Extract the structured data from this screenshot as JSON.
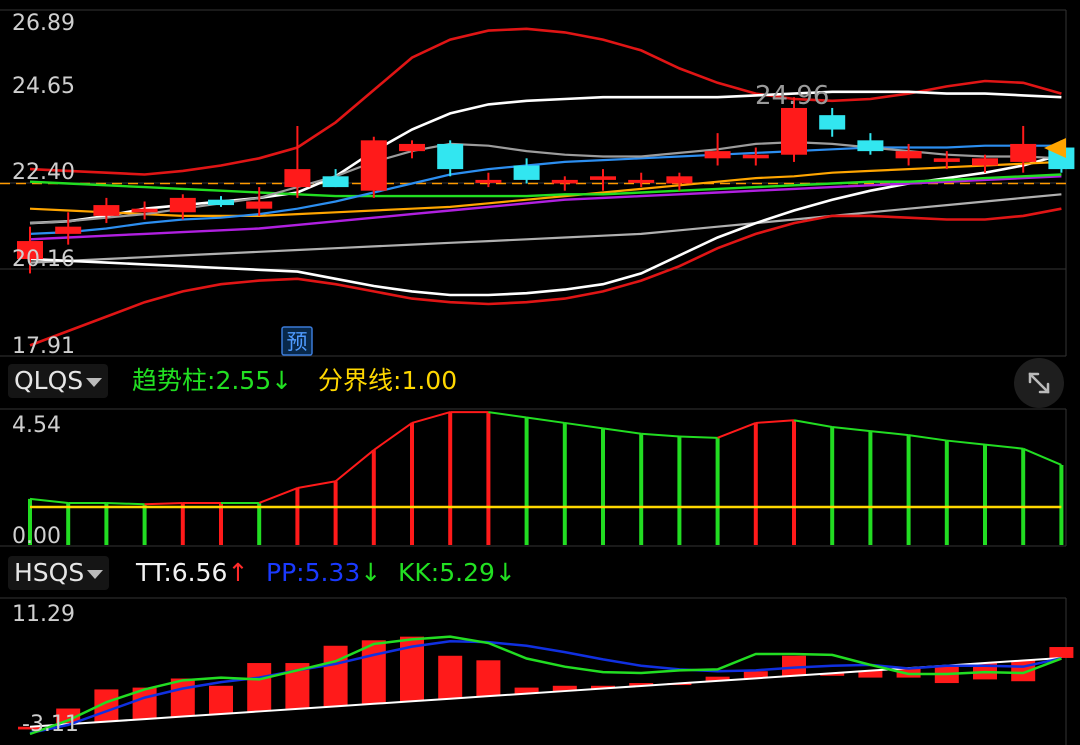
{
  "top_panel": {
    "y_labels": [
      "26.89",
      "24.65",
      "22.40",
      "20.16",
      "17.91"
    ],
    "price_tag": "24.96",
    "pre_badge": "预"
  },
  "mid_panel": {
    "indicator": "QLQS",
    "line1_label": "趋势柱:",
    "line1_value": "2.55",
    "line1_arrow": "↓",
    "line2_label": "分界线:",
    "line2_value": "1.00",
    "y_labels": [
      "4.54",
      "0.00"
    ]
  },
  "bot_panel": {
    "indicator": "HSQS",
    "tt_label": "TT:",
    "tt_value": "6.56",
    "tt_arrow": "↑",
    "pp_label": "PP:",
    "pp_value": "5.33",
    "pp_arrow": "↓",
    "kk_label": "KK:",
    "kk_value": "5.29",
    "kk_arrow": "↓",
    "y_labels": [
      "11.29",
      "-3.11"
    ]
  },
  "colors": {
    "up": "#ff1a1a",
    "down": "#32e6f0",
    "green": "#22dd22",
    "yellow": "#ffd700",
    "blue": "#1030e0",
    "white": "#ffffff"
  },
  "chart_data": [
    {
      "type": "candlestick",
      "ylim": [
        17.91,
        26.89
      ],
      "y_ticks": [
        26.89,
        24.65,
        22.4,
        20.16,
        17.91
      ],
      "reference_line": 22.4,
      "candles": [
        {
          "o": 20.3,
          "h": 21.2,
          "l": 19.9,
          "c": 20.8,
          "dir": "up"
        },
        {
          "o": 21.0,
          "h": 21.6,
          "l": 20.7,
          "c": 21.2,
          "dir": "up"
        },
        {
          "o": 21.5,
          "h": 22.0,
          "l": 21.3,
          "c": 21.8,
          "dir": "up"
        },
        {
          "o": 21.6,
          "h": 21.9,
          "l": 21.4,
          "c": 21.7,
          "dir": "up"
        },
        {
          "o": 21.6,
          "h": 22.1,
          "l": 21.4,
          "c": 22.0,
          "dir": "up"
        },
        {
          "o": 21.95,
          "h": 22.05,
          "l": 21.75,
          "c": 21.8,
          "dir": "down"
        },
        {
          "o": 21.7,
          "h": 22.3,
          "l": 21.5,
          "c": 21.9,
          "dir": "up"
        },
        {
          "o": 22.3,
          "h": 24.0,
          "l": 22.0,
          "c": 22.8,
          "dir": "up"
        },
        {
          "o": 22.6,
          "h": 22.8,
          "l": 22.3,
          "c": 22.3,
          "dir": "down"
        },
        {
          "o": 22.2,
          "h": 23.7,
          "l": 22.0,
          "c": 23.6,
          "dir": "up"
        },
        {
          "o": 23.3,
          "h": 23.6,
          "l": 23.1,
          "c": 23.5,
          "dir": "up"
        },
        {
          "o": 23.5,
          "h": 23.6,
          "l": 22.6,
          "c": 22.8,
          "dir": "down"
        },
        {
          "o": 22.5,
          "h": 22.7,
          "l": 22.3,
          "c": 22.5,
          "dir": "up"
        },
        {
          "o": 22.9,
          "h": 23.1,
          "l": 22.4,
          "c": 22.5,
          "dir": "down"
        },
        {
          "o": 22.4,
          "h": 22.6,
          "l": 22.2,
          "c": 22.5,
          "dir": "up"
        },
        {
          "o": 22.5,
          "h": 22.8,
          "l": 22.2,
          "c": 22.6,
          "dir": "up"
        },
        {
          "o": 22.5,
          "h": 22.7,
          "l": 22.3,
          "c": 22.5,
          "dir": "up"
        },
        {
          "o": 22.4,
          "h": 22.7,
          "l": 22.2,
          "c": 22.6,
          "dir": "up"
        },
        {
          "o": 23.1,
          "h": 23.8,
          "l": 22.9,
          "c": 23.3,
          "dir": "up"
        },
        {
          "o": 23.1,
          "h": 23.4,
          "l": 22.9,
          "c": 23.2,
          "dir": "up"
        },
        {
          "o": 23.2,
          "h": 24.8,
          "l": 23.0,
          "c": 24.5,
          "dir": "up"
        },
        {
          "o": 24.3,
          "h": 24.5,
          "l": 23.7,
          "c": 23.9,
          "dir": "down"
        },
        {
          "o": 23.6,
          "h": 23.8,
          "l": 23.2,
          "c": 23.3,
          "dir": "down"
        },
        {
          "o": 23.1,
          "h": 23.5,
          "l": 22.9,
          "c": 23.3,
          "dir": "up"
        },
        {
          "o": 23.0,
          "h": 23.3,
          "l": 22.8,
          "c": 23.1,
          "dir": "up"
        },
        {
          "o": 22.9,
          "h": 23.2,
          "l": 22.7,
          "c": 23.1,
          "dir": "up"
        },
        {
          "o": 23.0,
          "h": 24.0,
          "l": 22.7,
          "c": 23.5,
          "dir": "up"
        },
        {
          "o": 23.4,
          "h": 23.6,
          "l": 22.7,
          "c": 22.8,
          "dir": "down"
        }
      ],
      "lines": {
        "red_upper": [
          22.8,
          22.75,
          22.7,
          22.65,
          22.75,
          22.9,
          23.1,
          23.4,
          24.1,
          25.0,
          25.9,
          26.4,
          26.65,
          26.7,
          26.6,
          26.4,
          26.1,
          25.6,
          25.2,
          24.9,
          24.75,
          24.7,
          24.75,
          24.9,
          25.1,
          25.25,
          25.2,
          24.9
        ],
        "red_lower": [
          17.9,
          18.3,
          18.7,
          19.1,
          19.4,
          19.6,
          19.7,
          19.75,
          19.6,
          19.4,
          19.2,
          19.1,
          19.05,
          19.1,
          19.2,
          19.4,
          19.7,
          20.1,
          20.6,
          21.0,
          21.3,
          21.5,
          21.5,
          21.45,
          21.4,
          21.4,
          21.5,
          21.7
        ],
        "white_upper": [
          21.3,
          21.35,
          21.5,
          21.7,
          21.8,
          21.9,
          22.0,
          22.15,
          22.6,
          23.3,
          23.9,
          24.35,
          24.6,
          24.7,
          24.75,
          24.8,
          24.8,
          24.8,
          24.8,
          24.85,
          24.9,
          24.95,
          24.95,
          24.95,
          24.9,
          24.9,
          24.85,
          24.8
        ],
        "white_lower": [
          20.3,
          20.25,
          20.2,
          20.15,
          20.1,
          20.05,
          20.0,
          19.95,
          19.75,
          19.55,
          19.4,
          19.3,
          19.3,
          19.35,
          19.45,
          19.6,
          19.9,
          20.4,
          20.9,
          21.3,
          21.65,
          21.95,
          22.2,
          22.4,
          22.55,
          22.7,
          22.9,
          23.2
        ],
        "blue": [
          21.0,
          21.05,
          21.15,
          21.3,
          21.4,
          21.45,
          21.55,
          21.7,
          21.9,
          22.15,
          22.4,
          22.65,
          22.8,
          22.9,
          23.0,
          23.05,
          23.1,
          23.15,
          23.2,
          23.25,
          23.3,
          23.35,
          23.4,
          23.4,
          23.4,
          23.45,
          23.45,
          23.45
        ],
        "gray_short": [
          21.3,
          21.35,
          21.45,
          21.55,
          21.7,
          21.85,
          22.0,
          22.3,
          22.6,
          23.0,
          23.3,
          23.5,
          23.45,
          23.3,
          23.2,
          23.15,
          23.15,
          23.25,
          23.35,
          23.5,
          23.55,
          23.5,
          23.4,
          23.3,
          23.2,
          23.15,
          23.15,
          23.1
        ],
        "purple": [
          20.85,
          20.9,
          20.95,
          21.0,
          21.05,
          21.1,
          21.15,
          21.25,
          21.35,
          21.45,
          21.55,
          21.65,
          21.75,
          21.85,
          21.95,
          22.0,
          22.05,
          22.1,
          22.15,
          22.2,
          22.25,
          22.3,
          22.35,
          22.4,
          22.45,
          22.5,
          22.55,
          22.6
        ],
        "orange": [
          21.7,
          21.65,
          21.6,
          21.55,
          21.5,
          21.5,
          21.5,
          21.55,
          21.6,
          21.65,
          21.7,
          21.75,
          21.85,
          21.95,
          22.05,
          22.15,
          22.25,
          22.35,
          22.45,
          22.55,
          22.6,
          22.7,
          22.75,
          22.8,
          22.85,
          22.9,
          22.95,
          23.0
        ],
        "green": [
          22.45,
          22.4,
          22.35,
          22.3,
          22.25,
          22.2,
          22.15,
          22.1,
          22.05,
          22.05,
          22.05,
          22.05,
          22.05,
          22.05,
          22.1,
          22.1,
          22.15,
          22.2,
          22.25,
          22.3,
          22.35,
          22.4,
          22.45,
          22.45,
          22.5,
          22.55,
          22.6,
          22.65
        ],
        "gray_long": [
          20.2,
          20.25,
          20.3,
          20.35,
          20.4,
          20.45,
          20.5,
          20.55,
          20.6,
          20.65,
          20.7,
          20.75,
          20.8,
          20.85,
          20.9,
          20.95,
          21.0,
          21.1,
          21.2,
          21.3,
          21.4,
          21.5,
          21.6,
          21.7,
          21.8,
          21.9,
          22.0,
          22.1
        ]
      }
    },
    {
      "type": "bar",
      "ylim": [
        -0.4,
        4.54
      ],
      "y_ticks": [
        4.54,
        0.0
      ],
      "series": [
        {
          "name": "趋势柱",
          "values": [
            1.3,
            1.15,
            1.15,
            1.1,
            1.15,
            1.15,
            1.15,
            1.7,
            1.95,
            3.1,
            4.1,
            4.5,
            4.5,
            4.3,
            4.1,
            3.9,
            3.7,
            3.6,
            3.55,
            4.1,
            4.2,
            3.95,
            3.8,
            3.65,
            3.45,
            3.3,
            3.15,
            2.55
          ],
          "colors": [
            "green",
            "green",
            "green",
            "green",
            "red",
            "red",
            "green",
            "red",
            "red",
            "red",
            "red",
            "red",
            "red",
            "green",
            "green",
            "green",
            "green",
            "green",
            "green",
            "red",
            "red",
            "green",
            "green",
            "green",
            "green",
            "green",
            "green",
            "green"
          ]
        },
        {
          "name": "分界线",
          "values": [
            1.0,
            1.0,
            1.0,
            1.0,
            1.0,
            1.0,
            1.0,
            1.0,
            1.0,
            1.0,
            1.0,
            1.0,
            1.0,
            1.0,
            1.0,
            1.0,
            1.0,
            1.0,
            1.0,
            1.0,
            1.0,
            1.0,
            1.0,
            1.0,
            1.0,
            1.0,
            1.0,
            1.0
          ]
        }
      ]
    },
    {
      "type": "bar",
      "ylim": [
        -3.11,
        11.29
      ],
      "y_ticks": [
        11.29,
        -3.11
      ],
      "series": [
        {
          "name": "TT",
          "values": [
            -2.5,
            -0.2,
            1.9,
            2.1,
            3.1,
            2.3,
            4.8,
            4.8,
            6.7,
            7.3,
            7.7,
            5.6,
            5.1,
            2.1,
            2.3,
            2.3,
            2.6,
            2.6,
            3.3,
            3.9,
            5.6,
            3.4,
            3.2,
            3.2,
            2.6,
            3.0,
            2.8,
            6.56
          ]
        },
        {
          "name": "PP",
          "values": [
            -2.9,
            -2.0,
            -0.5,
            1.0,
            2.0,
            2.7,
            3.2,
            4.0,
            4.7,
            5.7,
            6.6,
            7.2,
            7.1,
            6.7,
            6.0,
            5.2,
            4.5,
            4.1,
            3.9,
            4.0,
            4.3,
            4.5,
            4.6,
            4.2,
            4.5,
            4.5,
            4.4,
            5.33
          ]
        },
        {
          "name": "KK",
          "values": [
            -3.0,
            -1.5,
            0.5,
            1.9,
            2.9,
            3.2,
            3.0,
            4.0,
            5.0,
            6.9,
            7.4,
            7.7,
            7.0,
            5.3,
            4.4,
            3.8,
            3.7,
            4.0,
            4.1,
            5.8,
            5.8,
            5.7,
            4.6,
            3.6,
            3.6,
            3.8,
            3.7,
            5.29
          ]
        }
      ]
    }
  ]
}
